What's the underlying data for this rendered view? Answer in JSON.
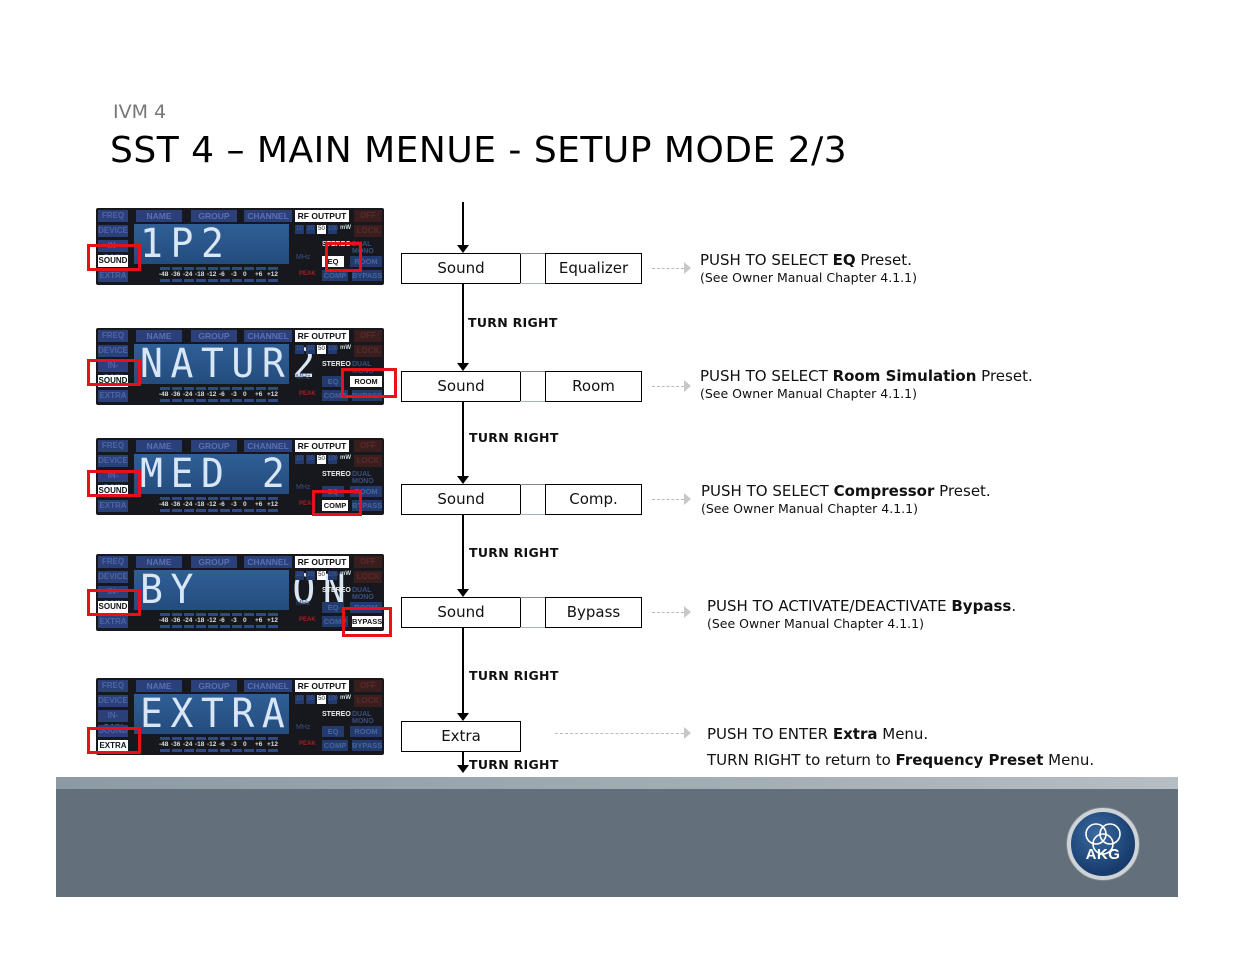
{
  "header": {
    "subtitle": "IVM 4",
    "title": "SST 4 – MAIN MENUE - SETUP MODE 2/3"
  },
  "lcd_common": {
    "side_buttons": [
      "FREQ",
      "DEVICE",
      "IN-GAIN",
      "SOUND",
      "EXTRA"
    ],
    "top_tabs": [
      "NAME",
      "GROUP",
      "CHANNEL"
    ],
    "rf_output_label": "RF OUTPUT",
    "off_label": "OFF",
    "lock_label": "LOCK",
    "power_levels": [
      "10",
      "20",
      "50",
      "100"
    ],
    "selected_power": "50",
    "mw_label": "mW",
    "mhz_label": "MHz",
    "stereo_label": "STEREO",
    "dual_mono_label": "DUAL MONO",
    "fx_buttons": [
      "EQ",
      "ROOM",
      "COMP",
      "BYPASS"
    ],
    "meter_labels": [
      "-48",
      "-36",
      "-24",
      "-18",
      "-12",
      "-6",
      "-3",
      "0",
      "+6",
      "+12"
    ],
    "peak_label": "PEAK",
    "input_label": "INPUT R"
  },
  "steps": [
    {
      "display_text": "1P2",
      "active_side": "SOUND",
      "active_fx": "EQ",
      "menu_label": "Sound",
      "submenu_label": "Equalizer",
      "desc_prefix": "PUSH TO SELECT ",
      "desc_bold": "EQ",
      "desc_suffix": " Preset.",
      "note": "(See Owner Manual Chapter 4.1.1)",
      "turn_label": "TURN RIGHT"
    },
    {
      "display_text": "NATUR2",
      "active_side": "SOUND",
      "active_fx": "ROOM",
      "menu_label": "Sound",
      "submenu_label": "Room",
      "desc_prefix": "PUSH TO SELECT ",
      "desc_bold": "Room Simulation",
      "desc_suffix": " Preset.",
      "note": "(See Owner Manual Chapter 4.1.1)",
      "turn_label": "TURN RIGHT"
    },
    {
      "display_text": "MED 2",
      "active_side": "SOUND",
      "active_fx": "COMP",
      "menu_label": "Sound",
      "submenu_label": "Comp.",
      "desc_prefix": "PUSH TO SELECT ",
      "desc_bold": "Compressor",
      "desc_suffix": " Preset.",
      "note": "(See Owner Manual Chapter 4.1.1)",
      "turn_label": "TURN RIGHT"
    },
    {
      "display_text": "BY   ON",
      "active_side": "SOUND",
      "active_fx": "BYPASS",
      "menu_label": "Sound",
      "submenu_label": "Bypass",
      "desc_prefix": "PUSH TO ACTIVATE/DEACTIVATE ",
      "desc_bold": "Bypass",
      "desc_suffix": ".",
      "note": "(See Owner Manual Chapter 4.1.1)",
      "turn_label": "TURN RIGHT"
    },
    {
      "display_text": "EXTRA",
      "active_side": "EXTRA",
      "active_fx": "",
      "menu_label": "Extra",
      "desc_prefix": "PUSH TO ENTER ",
      "desc_bold": "Extra",
      "desc_suffix": " Menu.",
      "desc2_prefix": "TURN RIGHT to return to ",
      "desc2_bold": "Frequency Preset",
      "desc2_suffix": " Menu.",
      "turn_label": "TURN RIGHT"
    }
  ],
  "footer": {
    "logo_text": "AKG",
    "background_color": "#636f7b"
  },
  "colors": {
    "highlight": "#e8101a",
    "lcd_screen": "#2f5f96"
  }
}
